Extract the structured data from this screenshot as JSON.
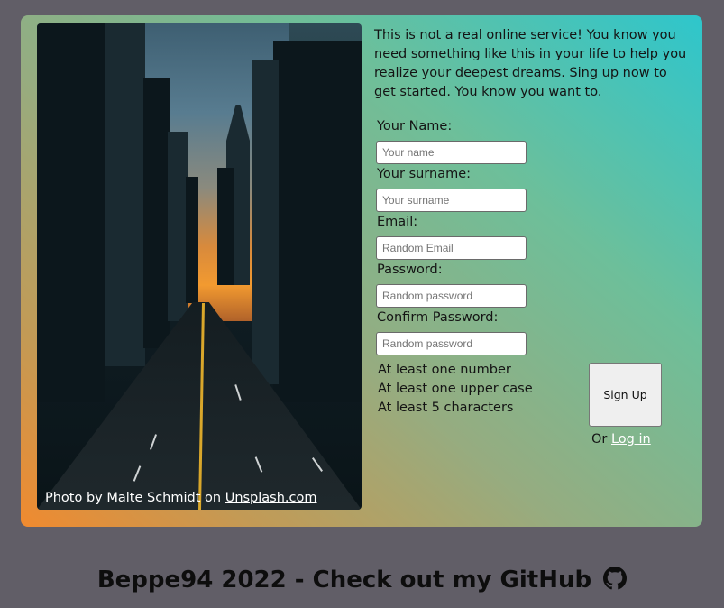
{
  "intro_text": "This is not a real online service! You know you need something like this in your life to help you realize your deepest dreams. Sing up now to get started. You know you want to.",
  "photo": {
    "credit_prefix": "Photo by Malte Schmidt on ",
    "credit_link": "Unsplash.com"
  },
  "form": {
    "fields": [
      {
        "label": "Your Name:",
        "placeholder": "Your name"
      },
      {
        "label": "Your surname:",
        "placeholder": "Your surname"
      },
      {
        "label": "Email:",
        "placeholder": "Random Email"
      },
      {
        "label": "Password:",
        "placeholder": "Random password"
      },
      {
        "label": "Confirm Password:",
        "placeholder": "Random password"
      }
    ],
    "rules": [
      "At least one number",
      "At least one upper case",
      "At least 5 characters"
    ],
    "signup_label": "Sign Up",
    "login_prefix": "Or ",
    "login_link": "Log in"
  },
  "footer": {
    "text": "Beppe94 2022 - Check out my GitHub",
    "icon": "github-icon"
  },
  "colors": {
    "page_bg": "#615e67",
    "gradient_orange": "#f08a2f",
    "gradient_teal": "#2ec6cc"
  }
}
